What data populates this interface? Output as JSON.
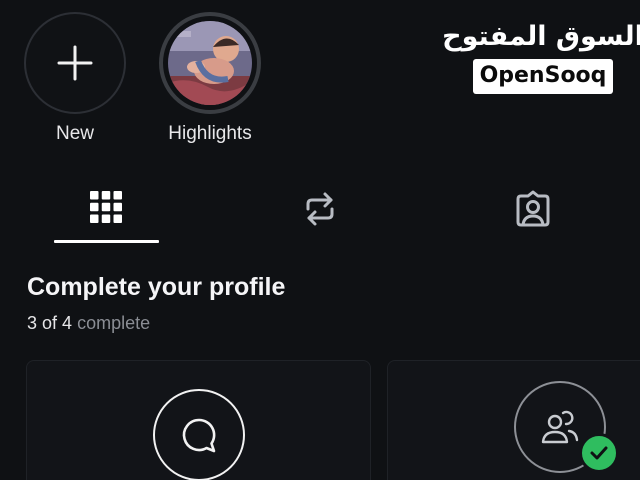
{
  "highlights": {
    "new": {
      "label": "New",
      "icon": "plus-icon"
    },
    "highlights": {
      "label": "Highlights",
      "icon": "child-photo"
    }
  },
  "logo": {
    "arabic": "السوق المفتوح",
    "latin": "OpenSooq"
  },
  "tabs": [
    {
      "name": "grid",
      "icon": "grid-icon",
      "selected": true
    },
    {
      "name": "reposts",
      "icon": "repost-icon",
      "selected": false
    },
    {
      "name": "tagged",
      "icon": "tagged-person-icon",
      "selected": false
    }
  ],
  "complete_profile": {
    "title": "Complete your profile",
    "count": "3 of 4",
    "word": "complete"
  },
  "cards": [
    {
      "icon": "chat-bubble-icon",
      "completed": false
    },
    {
      "icon": "people-icon",
      "completed": true
    }
  ],
  "colors": {
    "background": "#0f1114",
    "text": "#f4f4f5",
    "muted": "#8a8d94",
    "check": "#2fbd5f"
  }
}
